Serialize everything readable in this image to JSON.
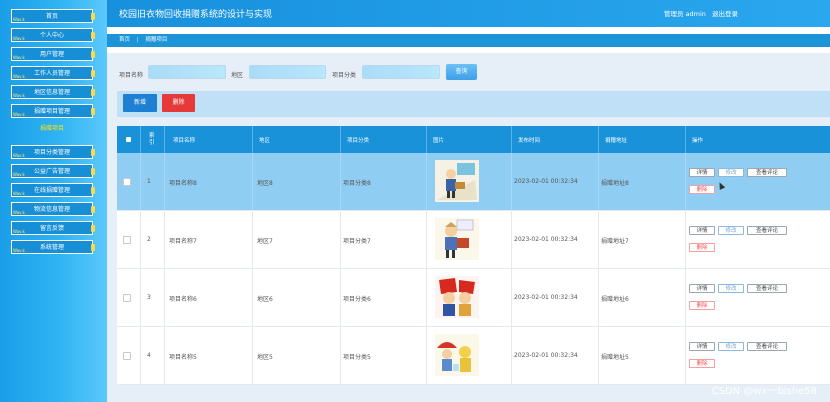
{
  "sidebar": {
    "items": [
      {
        "label": "首页",
        "active": false
      },
      {
        "label": "个人中心",
        "active": false
      },
      {
        "label": "用户管理",
        "active": false
      },
      {
        "label": "工作人员管理",
        "active": false
      },
      {
        "label": "地区信息管理",
        "active": false
      },
      {
        "label": "捐赠项目管理",
        "active": false
      },
      {
        "label": "捐赠项目",
        "active": true
      },
      {
        "label": "项目分类管理",
        "active": false
      },
      {
        "label": "公益广告管理",
        "active": false
      },
      {
        "label": "在线捐赠管理",
        "active": false
      },
      {
        "label": "物流信息管理",
        "active": false
      },
      {
        "label": "留言反馈",
        "active": false
      },
      {
        "label": "系统管理",
        "active": false
      }
    ]
  },
  "header": {
    "title": "校园旧衣物回收捐赠系统的设计与实现",
    "role": "管理员 admin",
    "logout": "退出登录"
  },
  "breadcrumb": {
    "home": "首页",
    "separator": "|",
    "current": "捐赠项目"
  },
  "search": {
    "name_label": "项目名称",
    "region_label": "地区",
    "category_label": "项目分类",
    "name_value": "",
    "region_value": "",
    "category_value": "",
    "query_button": "查询"
  },
  "actions": {
    "add": "新增",
    "delete": "删除"
  },
  "table": {
    "columns": [
      "",
      "索引",
      "项目名称",
      "地区",
      "项目分类",
      "图片",
      "发布时间",
      "捐赠地址",
      "操作"
    ],
    "rows": [
      {
        "index": "1",
        "name": "项目名称8",
        "region": "地区8",
        "category": "项目分类8",
        "time": "2023-02-01 00:32:34",
        "address": "捐赠地址8",
        "highlighted": true
      },
      {
        "index": "2",
        "name": "项目名称7",
        "region": "地区7",
        "category": "项目分类7",
        "time": "2023-02-01 00:32:34",
        "address": "捐赠地址7",
        "highlighted": false
      },
      {
        "index": "3",
        "name": "项目名称6",
        "region": "地区6",
        "category": "项目分类6",
        "time": "2023-02-01 00:32:34",
        "address": "捐赠地址6",
        "highlighted": false
      },
      {
        "index": "4",
        "name": "项目名称5",
        "region": "地区5",
        "category": "项目分类5",
        "time": "2023-02-01 00:32:34",
        "address": "捐赠地址5",
        "highlighted": false
      }
    ],
    "row_buttons": {
      "detail": "详情",
      "edit": "修改",
      "comments": "查看评论",
      "delete": "删除"
    }
  },
  "watermark": "CSDN @wx一bishe58",
  "colors": {
    "sidebar": "#1a9ee8",
    "header": "#1790dd",
    "table_header": "#1a92d9",
    "highlight_row": "#8fcdf2",
    "delete": "#e6393a"
  }
}
